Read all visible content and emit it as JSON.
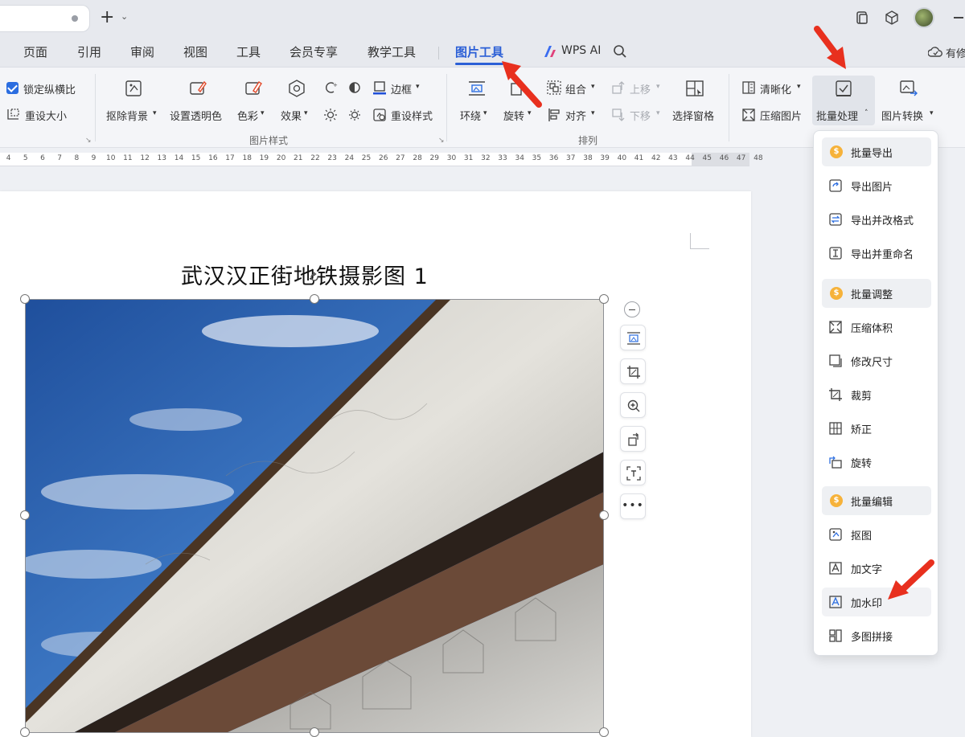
{
  "titlebar": {
    "new_tab": "+",
    "new_tab_caret": "⌄"
  },
  "menubar": {
    "tabs": [
      {
        "label": "页面"
      },
      {
        "label": "引用"
      },
      {
        "label": "审阅"
      },
      {
        "label": "视图"
      },
      {
        "label": "工具"
      },
      {
        "label": "会员专享"
      },
      {
        "label": "教学工具"
      },
      {
        "label": "图片工具",
        "active": true
      },
      {
        "label": "WPS AI"
      }
    ],
    "right_partial": "有修"
  },
  "ribbon": {
    "size_group": {
      "lock_ratio": "锁定纵横比",
      "reset_size": "重设大小"
    },
    "style_group": {
      "label": "图片样式",
      "remove_bg": "抠除背景",
      "transparent": "设置透明色",
      "color": "色彩",
      "effect": "效果",
      "border": "边框",
      "reset_style": "重设样式"
    },
    "arrange_group": {
      "label": "排列",
      "wrap": "环绕",
      "rotate": "旋转",
      "group": "组合",
      "align": "对齐",
      "bring_up": "上移",
      "send_down": "下移",
      "selection_pane": "选择窗格"
    },
    "process_group": {
      "clarity": "清晰化",
      "compress": "压缩图片",
      "batch": "批量处理",
      "convert": "图片转换"
    }
  },
  "ruler": {
    "numbers": [
      "4",
      "5",
      "6",
      "7",
      "8",
      "9",
      "10",
      "11",
      "12",
      "13",
      "14",
      "15",
      "16",
      "17",
      "18",
      "19",
      "20",
      "21",
      "22",
      "23",
      "24",
      "25",
      "26",
      "27",
      "28",
      "29",
      "30",
      "31",
      "32",
      "33",
      "34",
      "35",
      "36",
      "37",
      "38",
      "39",
      "40",
      "41",
      "42",
      "43",
      "44",
      "45",
      "46",
      "47",
      "48"
    ]
  },
  "document": {
    "title": "武汉汉正街地铁摄影图 1"
  },
  "float_tools": {
    "more": "•••"
  },
  "dropdown": {
    "items": [
      {
        "label": "批量导出",
        "type": "header"
      },
      {
        "label": "导出图片"
      },
      {
        "label": "导出并改格式"
      },
      {
        "label": "导出并重命名"
      },
      {
        "label": "批量调整",
        "type": "header"
      },
      {
        "label": "压缩体积"
      },
      {
        "label": "修改尺寸"
      },
      {
        "label": "裁剪"
      },
      {
        "label": "矫正"
      },
      {
        "label": "旋转"
      },
      {
        "label": "批量编辑",
        "type": "header"
      },
      {
        "label": "抠图"
      },
      {
        "label": "加文字"
      },
      {
        "label": "加水印"
      },
      {
        "label": "多图拼接"
      }
    ],
    "coin_glyph": "$"
  },
  "colors": {
    "accent": "#2b5fd6",
    "arrow": "#e8301e",
    "coin": "#f6b23a"
  }
}
